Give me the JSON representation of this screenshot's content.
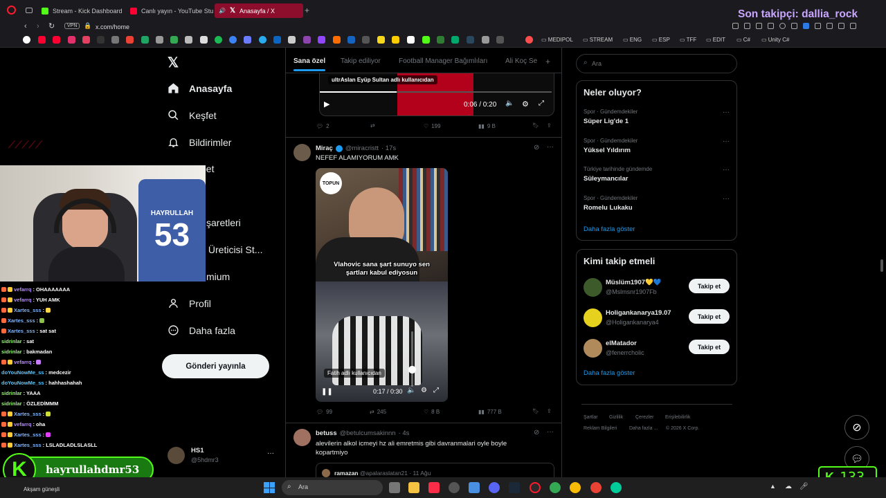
{
  "browser": {
    "tabs": [
      {
        "label": "Stream - Kick Dashboard"
      },
      {
        "label": "Canlı yayın - YouTube Studio"
      },
      {
        "label": "Anasayfa / X"
      }
    ],
    "url": "x.com/home",
    "vpn": "VPN",
    "bookmark_folders": [
      "MEDIPOL",
      "STREAM",
      "ENG",
      "ESP",
      "TFF",
      "EDIT",
      "C#",
      "Unity C#"
    ]
  },
  "overlay": {
    "last_follower": "Son takipçi: dallia_rock",
    "kick_channel": "hayrullahdmr53",
    "viewer_count": "133"
  },
  "jersey": {
    "name": "HAYRULLAH",
    "number": "53"
  },
  "nav": {
    "items": [
      "Anasayfa",
      "Keşfet",
      "Bildirimler",
      "bet",
      "k",
      "şaretleri",
      "k Üreticisi St...",
      "mium",
      "Profil",
      "Daha fazla"
    ],
    "post_button": "Gönderi yayınla",
    "account": {
      "name": "HS1",
      "handle": "@5hdmr3"
    }
  },
  "timeline": {
    "tabs": [
      "Sana özel",
      "Takip ediliyor",
      "Football Manager Bağımlıları",
      "Ali Koç Se"
    ],
    "tweet1": {
      "video_label": "ultrAslan Eyüp Sultan adlı kullanıcıdan",
      "time": "0:06 / 0:20",
      "replies": "2",
      "likes": "199",
      "views": "9 B"
    },
    "tweet2": {
      "name": "Miraç",
      "handle": "@miracristt",
      "age": "· 17s",
      "text": "NEFEF ALAMIYORUM AMK",
      "video_logo": "TOPUN",
      "video_caption_line1": "Vlahovic sana şart sunuyo sen",
      "video_caption_line2": "şartları kabul ediyosun",
      "video_label": "Fatih adlı kullanıcıdan",
      "time": "0:17 / 0:30",
      "replies": "99",
      "retweets": "245",
      "likes": "8 B",
      "views": "777 B"
    },
    "tweet3": {
      "name": "betuss",
      "handle": "@betulcumsakinnn",
      "age": "· 4s",
      "text_line1": "alevilerin alkol icmeyi hz ali emretmis gibi davranmalari oyle boyle",
      "text_line2": "kopartmiyo",
      "quote_name": "ramazan",
      "quote_meta": "@apalaraslatan21 · 11 Ağu"
    }
  },
  "sidebar": {
    "search_placeholder": "Ara",
    "trends_title": "Neler oluyor?",
    "trends": [
      {
        "meta": "Spor · Gündemdekiler",
        "name": "Süper Lig'de 1"
      },
      {
        "meta": "Spor · Gündemdekiler",
        "name": "Yüksel Yıldırım"
      },
      {
        "meta": "Türkiye tarihinde gündemde",
        "name": "Süleymancılar"
      },
      {
        "meta": "Spor · Gündemdekiler",
        "name": "Romelu Lukaku"
      }
    ],
    "show_more": "Daha fazla göster",
    "who_to_follow_title": "Kimi takip etmeli",
    "suggestions": [
      {
        "name": "Müslüm1907💛💙",
        "handle": "@Mslmsnr1907Fb",
        "button": "Takip et"
      },
      {
        "name": "Holigankanarya19.07",
        "handle": "@Holigankanarya4",
        "button": "Takip et"
      },
      {
        "name": "elMatador",
        "handle": "@fenerrcholic",
        "button": "Takip et"
      }
    ],
    "footer_links": [
      "Şartlar",
      "Gizlilik",
      "Çerezler",
      "Erişilebilirlik",
      "Reklam Bilgileri",
      "Daha fazla ...",
      "© 2026 X Corp."
    ]
  },
  "chat": [
    {
      "user": "vefarrq",
      "msg": ": OHAAAAAAA",
      "color": "#b98cff"
    },
    {
      "user": "vefarrq",
      "msg": ": YUH AMK",
      "color": "#b98cff"
    },
    {
      "user": "Xartes_sss",
      "msg": ":",
      "color": "#7fb6ff"
    },
    {
      "user": "Xartes_sss",
      "msg": ":",
      "color": "#7fb6ff"
    },
    {
      "user": "Xartes_sss",
      "msg": ": sat sat",
      "color": "#7fb6ff"
    },
    {
      "user": "sidrinlar",
      "msg": ": sat",
      "color": "#8dff6a"
    },
    {
      "user": "sidrinlar",
      "msg": ": bakmadan",
      "color": "#8dff6a"
    },
    {
      "user": "vefarrq",
      "msg": ":",
      "color": "#b98cff"
    },
    {
      "user": "doYouNowMe_ss",
      "msg": ": medcezir",
      "color": "#5cc8ff"
    },
    {
      "user": "doYouNowMe_ss",
      "msg": ": hahhashahah",
      "color": "#5cc8ff"
    },
    {
      "user": "sidrinlar",
      "msg": ": YAAA",
      "color": "#8dff6a"
    },
    {
      "user": "sidrinlar",
      "msg": ": ÖZLEDİMMM",
      "color": "#8dff6a"
    },
    {
      "user": "Xartes_sss",
      "msg": ":",
      "color": "#7fb6ff"
    },
    {
      "user": "vefarrq",
      "msg": ": oha",
      "color": "#b98cff"
    },
    {
      "user": "Xartes_sss",
      "msg": ":",
      "color": "#7fb6ff"
    },
    {
      "user": "Xartes_sss",
      "msg": ": LSLADLADLSLASLL",
      "color": "#7fb6ff"
    }
  ],
  "taskbar": {
    "search_placeholder": "Ara",
    "weather": "Akşam güneşli"
  },
  "colors": {
    "accent": "#1d9bf0",
    "kick_green": "#53fc18",
    "overlay_purple": "#c9a6ff"
  }
}
